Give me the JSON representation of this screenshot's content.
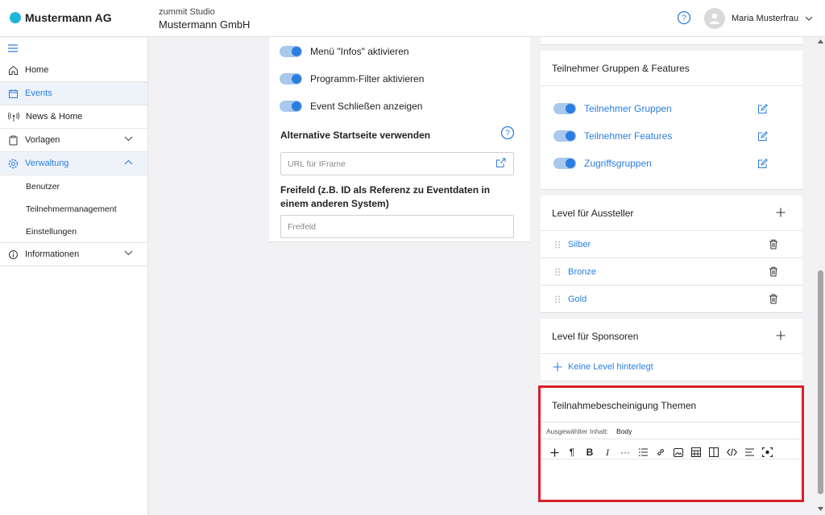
{
  "header": {
    "brand": "Mustermann AG",
    "studio_label": "zummit Studio",
    "company": "Mustermann GmbH",
    "help_icon": "help-circle-icon",
    "user_name": "Maria Musterfrau"
  },
  "sidebar": {
    "items": [
      {
        "label": "Home",
        "icon": "home-icon"
      },
      {
        "label": "Events",
        "icon": "calendar-icon",
        "active": true
      },
      {
        "label": "News & Home",
        "icon": "broadcast-icon"
      },
      {
        "label": "Vorlagen",
        "icon": "clipboard-icon"
      },
      {
        "label": "Verwaltung",
        "icon": "gear-icon",
        "active": true
      },
      {
        "label": "Informationen",
        "icon": "info-icon"
      }
    ],
    "sub_items": [
      "Benutzer",
      "Teilnehmermanagement",
      "Einstellungen"
    ]
  },
  "settings": {
    "toggles": [
      "Menü \"Infos\" aktivieren",
      "Programm-Filter aktivieren",
      "Event Schließen anzeigen"
    ],
    "startpage_label": "Alternative Startseite verwenden",
    "iframe_placeholder": "URL für IFrame",
    "freefield_label": "Freifeld (z.B. ID als Referenz zu Eventdaten in einem anderen System)",
    "freefield_placeholder": "Freifeld"
  },
  "groups": {
    "title": "Teilnehmer Gruppen & Features",
    "items": [
      "Teilnehmer Gruppen",
      "Teilnehmer Features",
      "Zugriffsgruppen"
    ]
  },
  "exhibitor_levels": {
    "title": "Level für Aussteller",
    "items": [
      "Silber",
      "Bronze",
      "Gold"
    ]
  },
  "sponsor_levels": {
    "title": "Level für Sponsoren",
    "empty_label": "Keine Level hinterlegt"
  },
  "certificate": {
    "title": "Teilnahmebescheinigung Themen",
    "selected_label": "Ausgewählter Inhalt:",
    "selected_value": "Body",
    "toolbar_icons": [
      "plus-icon",
      "paragraph-icon",
      "bold-icon",
      "italic-icon",
      "more-icon",
      "list-icon",
      "link-icon",
      "image-icon",
      "table-icon",
      "columns-icon",
      "code-icon",
      "align-icon",
      "embed-icon"
    ]
  },
  "colors": {
    "accent": "#2b7de0",
    "brand_dot": "#1fb5d9",
    "highlight_border": "#d9202a"
  }
}
